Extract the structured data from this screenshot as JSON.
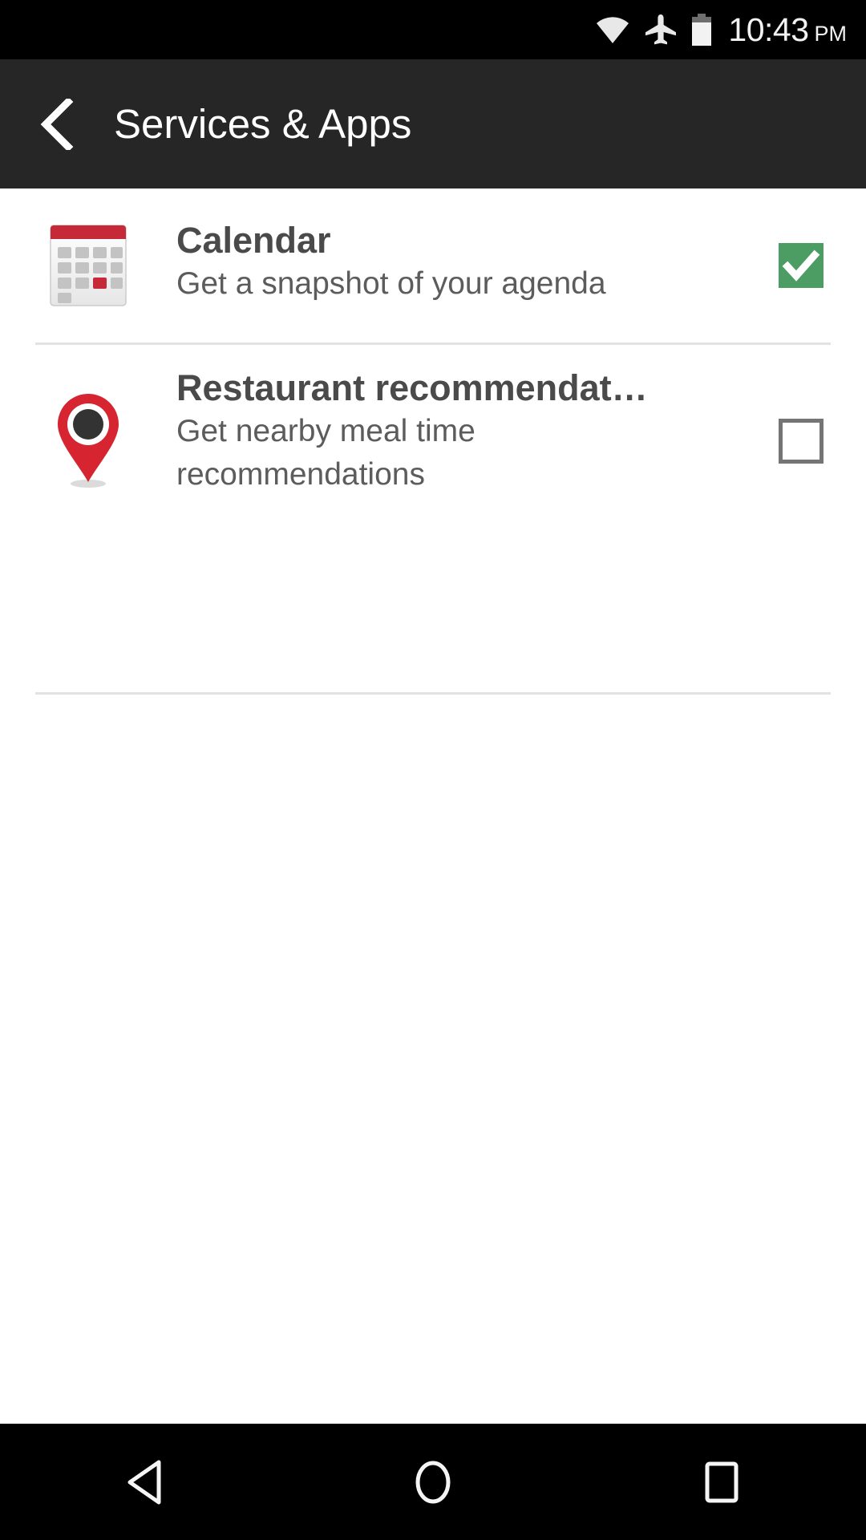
{
  "status_bar": {
    "time": "10:43",
    "am_pm": "PM",
    "icons": [
      "wifi-icon",
      "airplane-mode-icon",
      "battery-icon"
    ],
    "background_color": "#000000",
    "text_color": "#f2f2f2"
  },
  "app_bar": {
    "back_icon": "chevron-left-icon",
    "title": "Services & Apps",
    "background_color": "#262626",
    "title_color": "#ffffff"
  },
  "list": {
    "items": [
      {
        "icon": "calendar-icon",
        "title": "Calendar",
        "subtitle": "Get a snapshot of your agenda",
        "checked": true,
        "checkbox_color": "#4c9d63"
      },
      {
        "icon": "map-pin-icon",
        "title": "Restaurant recommendat…",
        "subtitle_line_1": "Get nearby meal time",
        "subtitle_line_2": "recommendations",
        "checked": false,
        "checkbox_color": "#757575"
      }
    ],
    "divider_color": "#e2e2e2",
    "background_color": "#ffffff",
    "title_color": "#4a4a4a",
    "subtitle_color": "#5c5c5c"
  },
  "nav_bar": {
    "background_color": "#000000",
    "buttons": [
      "nav-back-icon",
      "nav-home-icon",
      "nav-recents-icon"
    ]
  },
  "theme": {
    "accent_red": "#c62a38",
    "accent_green": "#4c9d63"
  }
}
